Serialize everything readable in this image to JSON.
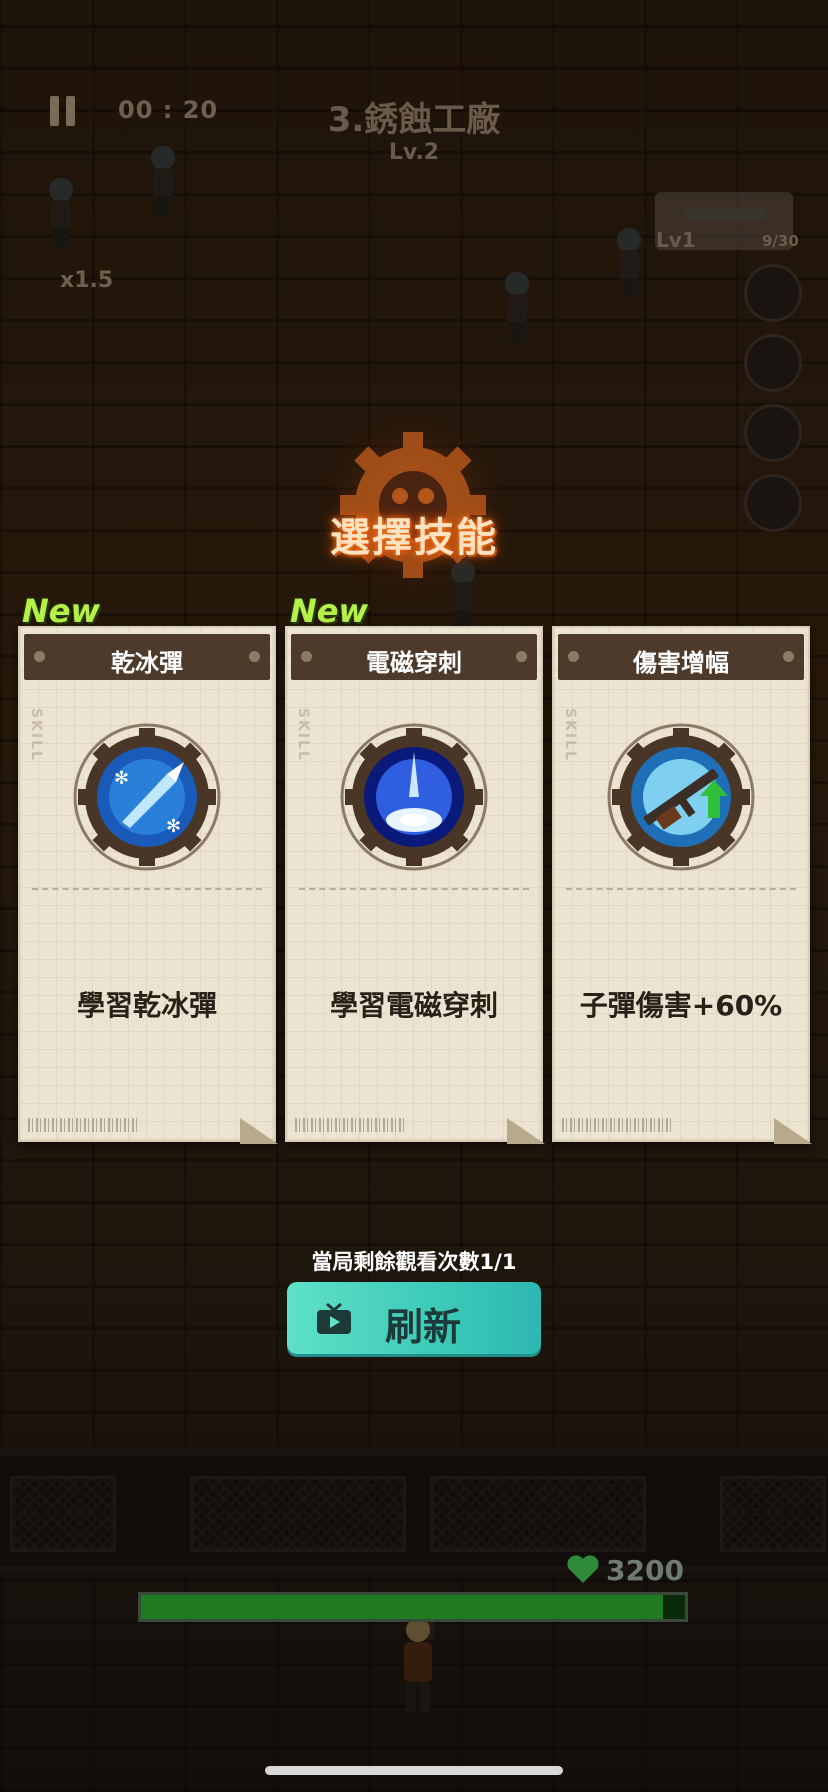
{
  "hud": {
    "timer": "00 : 20",
    "stage_title": "3.銹蝕工廠",
    "stage_level": "Lv.2",
    "multiplier": "x1.5",
    "weapon_level": "Lv1",
    "ammo": "9/30",
    "pause_icon": "pause-icon"
  },
  "dialog": {
    "title": "選擇技能",
    "cards": [
      {
        "new_label": "New",
        "name": "乾冰彈",
        "skill_tag": "SKILL",
        "description": "學習乾冰彈",
        "icon": "dry-ice-bullet-icon",
        "accent": "#2a7fd8"
      },
      {
        "new_label": "New",
        "name": "電磁穿刺",
        "skill_tag": "SKILL",
        "description": "學習電磁穿刺",
        "icon": "electromagnetic-pierce-icon",
        "accent": "#2f5fe0"
      },
      {
        "new_label": "",
        "name": "傷害增幅",
        "skill_tag": "SKILL",
        "description": "子彈傷害+60%",
        "icon": "rifle-damage-up-icon",
        "accent": "#3aa6e0"
      }
    ],
    "watch_remaining": "當局剩餘觀看次數1/1",
    "refresh_label": "刷新",
    "refresh_icon": "tv-ad-icon"
  },
  "base": {
    "hp": "3200",
    "hp_fraction": 0.96,
    "heart_icon": "heart-icon"
  },
  "colors": {
    "title_glow": "#ff7a1a",
    "new_badge": "#b6f04a",
    "refresh_button": "#3ccab8",
    "card_header": "#4d3a2a",
    "hp_bar": "#1f7a22"
  }
}
